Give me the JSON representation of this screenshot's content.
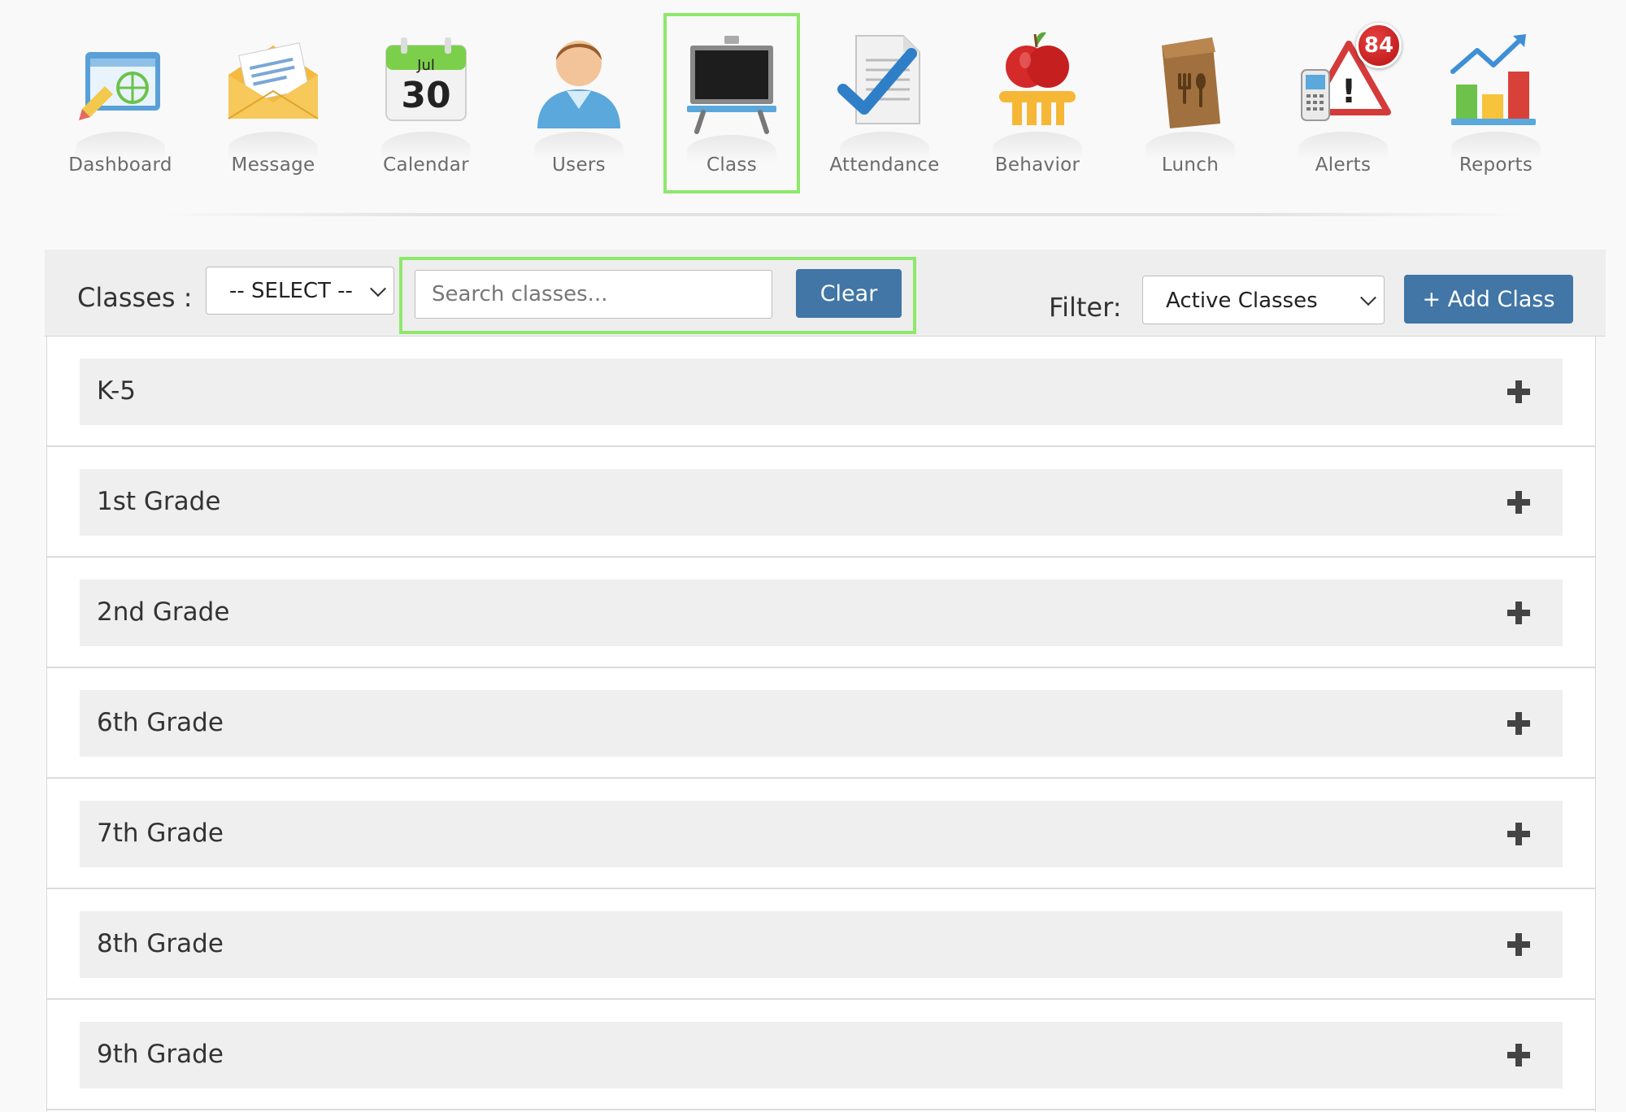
{
  "nav": {
    "items": [
      {
        "label": "Dashboard",
        "icon": "dashboard-icon"
      },
      {
        "label": "Message",
        "icon": "envelope-icon"
      },
      {
        "label": "Calendar",
        "icon": "calendar-icon",
        "month": "Jul",
        "day": "30"
      },
      {
        "label": "Users",
        "icon": "user-icon"
      },
      {
        "label": "Class",
        "icon": "chalkboard-icon",
        "active": true
      },
      {
        "label": "Attendance",
        "icon": "checkmark-document-icon"
      },
      {
        "label": "Behavior",
        "icon": "apple-icon"
      },
      {
        "label": "Lunch",
        "icon": "lunch-bag-icon"
      },
      {
        "label": "Alerts",
        "icon": "alert-phone-icon",
        "badge": "84"
      },
      {
        "label": "Reports",
        "icon": "bar-chart-icon"
      }
    ]
  },
  "toolbar": {
    "classes_label": "Classes :",
    "classes_select_value": "-- SELECT --",
    "search_placeholder": "Search classes...",
    "clear_label": "Clear",
    "filter_label": "Filter:",
    "filter_value": "Active Classes",
    "add_label": "+ Add Class"
  },
  "classes": [
    {
      "name": "K-5"
    },
    {
      "name": "1st Grade"
    },
    {
      "name": "2nd Grade"
    },
    {
      "name": "6th Grade"
    },
    {
      "name": "7th Grade"
    },
    {
      "name": "8th Grade"
    },
    {
      "name": "9th Grade"
    }
  ],
  "colors": {
    "button": "#4176a6",
    "highlight": "#8ee86a",
    "badge": "#c41a1a"
  }
}
